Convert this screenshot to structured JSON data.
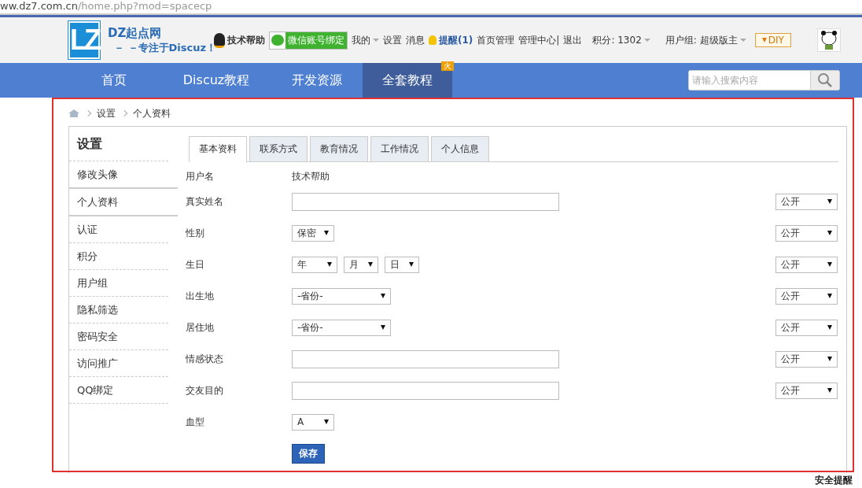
{
  "address_bar": {
    "host": "ww.dz7.com.cn",
    "path": "/home.php?mod=spacecp"
  },
  "header": {
    "logo_mark": "LZ",
    "logo_title": "DZ起点网",
    "logo_slogan": "－ －专注于Discuz！",
    "user_links": [
      {
        "kind": "qq",
        "text": "技术帮助"
      },
      {
        "kind": "wechat",
        "text": "微信账号绑定"
      },
      {
        "kind": "menu",
        "text": "我的"
      },
      {
        "kind": "link",
        "text": "设置"
      },
      {
        "kind": "link",
        "text": "消息"
      },
      {
        "kind": "alert",
        "text": "提醒(1)"
      },
      {
        "kind": "link",
        "text": "首页管理"
      },
      {
        "kind": "link",
        "text": "管理中心|"
      },
      {
        "kind": "link",
        "text": "退出"
      },
      {
        "kind": "menu",
        "text": "积分: 1302"
      },
      {
        "kind": "menu",
        "text": "用户组: 超级版主"
      },
      {
        "kind": "diy",
        "text": "DIY"
      },
      {
        "kind": "avatar"
      }
    ]
  },
  "nav": {
    "items": [
      {
        "label": "首页",
        "selected": false
      },
      {
        "label": "Discuz教程",
        "selected": false
      },
      {
        "label": "开发资源",
        "selected": false
      },
      {
        "label": "全套教程",
        "selected": true,
        "badge": "火"
      }
    ],
    "search": {
      "placeholder": "请输入搜索内容"
    }
  },
  "breadcrumb": [
    "设置",
    "个人资料"
  ],
  "sidebar": {
    "title": "设置",
    "items": [
      {
        "label": "修改头像",
        "selected": false
      },
      {
        "label": "个人资料",
        "selected": true
      },
      {
        "label": "认证",
        "selected": false
      },
      {
        "label": "积分",
        "selected": false
      },
      {
        "label": "用户组",
        "selected": false
      },
      {
        "label": "隐私筛选",
        "selected": false
      },
      {
        "label": "密码安全",
        "selected": false
      },
      {
        "label": "访问推广",
        "selected": false
      },
      {
        "label": "QQ绑定",
        "selected": false
      }
    ]
  },
  "tabs": [
    {
      "label": "基本资料",
      "selected": true
    },
    {
      "label": "联系方式",
      "selected": false
    },
    {
      "label": "教育情况",
      "selected": false
    },
    {
      "label": "工作情况",
      "selected": false
    },
    {
      "label": "个人信息",
      "selected": false
    }
  ],
  "form": {
    "rows": [
      {
        "label": "用户名",
        "kind": "text",
        "value": "技术帮助"
      },
      {
        "label": "真实姓名",
        "kind": "input",
        "privacy": "公开"
      },
      {
        "label": "性别",
        "kind": "select",
        "value": "保密",
        "privacy": "公开"
      },
      {
        "label": "生日",
        "kind": "date",
        "parts": [
          "年",
          "月",
          "日"
        ],
        "privacy": "公开"
      },
      {
        "label": "出生地",
        "kind": "wide_select",
        "value": "-省份-",
        "privacy": "公开"
      },
      {
        "label": "居住地",
        "kind": "wide_select",
        "value": "-省份-",
        "privacy": "公开"
      },
      {
        "label": "情感状态",
        "kind": "input",
        "privacy": "公开"
      },
      {
        "label": "交友目的",
        "kind": "input",
        "privacy": "公开"
      },
      {
        "label": "血型",
        "kind": "select",
        "value": "A"
      }
    ],
    "save_button": "保存"
  },
  "footer_note": "安全提醒"
}
